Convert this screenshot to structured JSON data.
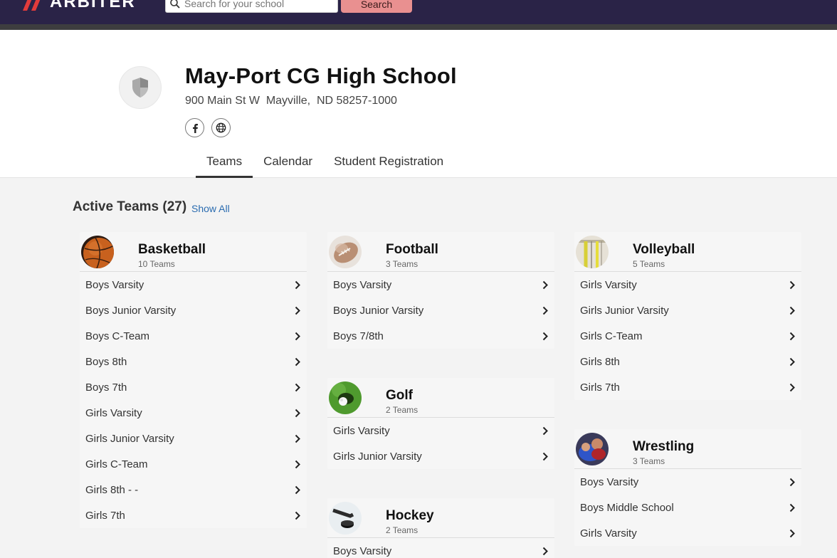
{
  "topbar": {
    "logo_text": "ARBITER",
    "search_placeholder": "Search for your school",
    "search_button": "Search"
  },
  "school": {
    "name": "May-Port CG High School",
    "address": "900 Main St W  Mayville,  ND 58257-1000"
  },
  "tabs": [
    {
      "label": "Teams",
      "active": true
    },
    {
      "label": "Calendar",
      "active": false
    },
    {
      "label": "Student Registration",
      "active": false
    }
  ],
  "section": {
    "title": "Active Teams (27)",
    "show_all": "Show All"
  },
  "sports": {
    "basketball": {
      "name": "Basketball",
      "count": "10 Teams",
      "teams": [
        "Boys Varsity",
        "Boys Junior Varsity",
        "Boys C-Team",
        "Boys 8th",
        "Boys 7th",
        "Girls Varsity",
        "Girls Junior Varsity",
        "Girls C-Team",
        "Girls 8th - -",
        "Girls 7th"
      ]
    },
    "football": {
      "name": "Football",
      "count": "3 Teams",
      "teams": [
        "Boys Varsity",
        "Boys Junior Varsity",
        "Boys 7/8th"
      ]
    },
    "golf": {
      "name": "Golf",
      "count": "2 Teams",
      "teams": [
        "Girls Varsity",
        "Girls Junior Varsity"
      ]
    },
    "hockey": {
      "name": "Hockey",
      "count": "2 Teams",
      "teams": [
        "Boys Varsity"
      ]
    },
    "volleyball": {
      "name": "Volleyball",
      "count": "5 Teams",
      "teams": [
        "Girls Varsity",
        "Girls Junior Varsity",
        "Girls C-Team",
        "Girls 8th",
        "Girls 7th"
      ]
    },
    "wrestling": {
      "name": "Wrestling",
      "count": "3 Teams",
      "teams": [
        "Boys Varsity",
        "Boys Middle School",
        "Girls Varsity"
      ]
    }
  },
  "colors": {
    "topbar": "#2a2347",
    "search_button": "#e99090",
    "link": "#2b6cb0"
  }
}
